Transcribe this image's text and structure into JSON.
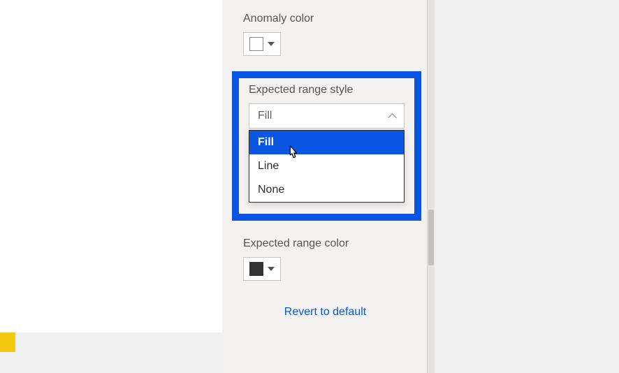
{
  "anomaly": {
    "label": "Anomaly color",
    "swatch_color": "#ffffff"
  },
  "rangeStyle": {
    "label": "Expected range style",
    "value": "Fill",
    "options": [
      "Fill",
      "Line",
      "None"
    ],
    "selected_index": 0
  },
  "rangeColor": {
    "label": "Expected range color",
    "swatch_color": "#333333"
  },
  "revert_label": "Revert to default"
}
